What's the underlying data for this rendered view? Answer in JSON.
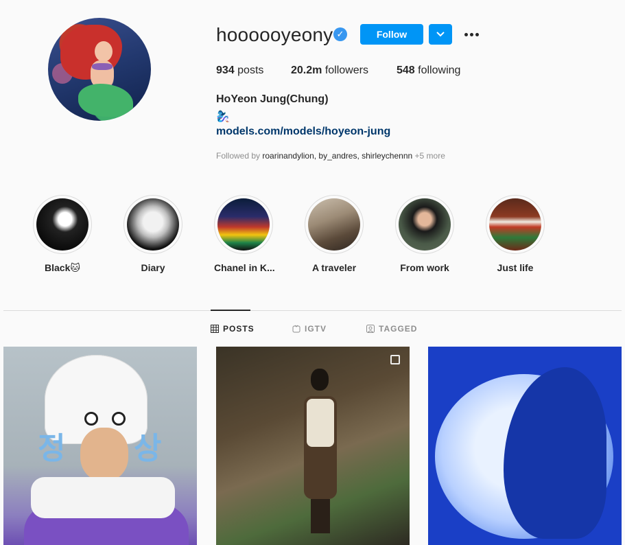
{
  "profile": {
    "username": "hoooooyeony",
    "verified_mark": "✓",
    "follow_label": "Follow",
    "stats": {
      "posts_count": "934",
      "posts_label": "posts",
      "followers_count": "20.2m",
      "followers_label": "followers",
      "following_count": "548",
      "following_label": "following"
    },
    "full_name": "HoYeon Jung(Chung)",
    "bio_emoji": "🧞‍♀️",
    "link": "models.com/models/hoyeon-jung",
    "followed_by_prefix": "Followed by",
    "followed_by_names": "roarinandylion, by_andres, shirleychennn",
    "followed_by_more": "+5 more"
  },
  "highlights": [
    {
      "label": "Black🐱"
    },
    {
      "label": "Diary"
    },
    {
      "label": "Chanel in K..."
    },
    {
      "label": "A traveler"
    },
    {
      "label": "From work"
    },
    {
      "label": "Just life"
    }
  ],
  "tabs": {
    "posts": "POSTS",
    "igtv": "IGTV",
    "tagged": "TAGGED"
  },
  "post1_text": {
    "left_char": "정",
    "right_char": "상"
  },
  "colors": {
    "accent": "#0095f6",
    "link": "#00376b",
    "verified": "#3897f0"
  }
}
